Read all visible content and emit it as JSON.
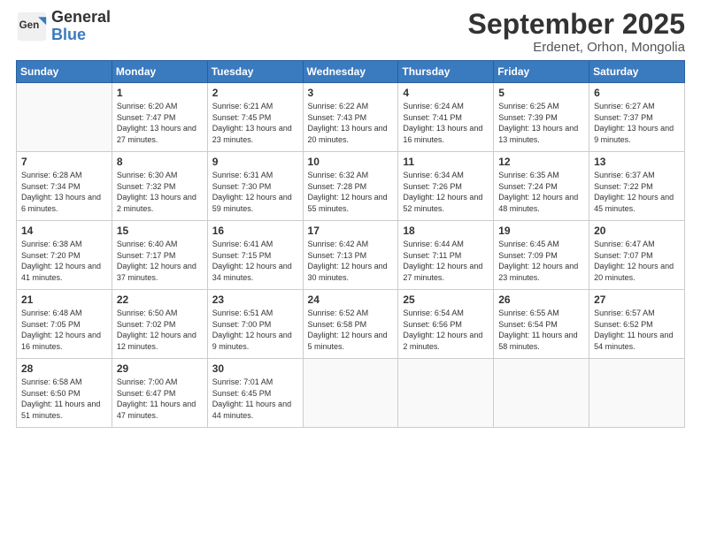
{
  "logo": {
    "general": "General",
    "blue": "Blue"
  },
  "title": {
    "month": "September 2025",
    "location": "Erdenet, Orhon, Mongolia"
  },
  "weekdays": [
    "Sunday",
    "Monday",
    "Tuesday",
    "Wednesday",
    "Thursday",
    "Friday",
    "Saturday"
  ],
  "weeks": [
    [
      {
        "day": "",
        "info": ""
      },
      {
        "day": "1",
        "info": "Sunrise: 6:20 AM\nSunset: 7:47 PM\nDaylight: 13 hours and 27 minutes."
      },
      {
        "day": "2",
        "info": "Sunrise: 6:21 AM\nSunset: 7:45 PM\nDaylight: 13 hours and 23 minutes."
      },
      {
        "day": "3",
        "info": "Sunrise: 6:22 AM\nSunset: 7:43 PM\nDaylight: 13 hours and 20 minutes."
      },
      {
        "day": "4",
        "info": "Sunrise: 6:24 AM\nSunset: 7:41 PM\nDaylight: 13 hours and 16 minutes."
      },
      {
        "day": "5",
        "info": "Sunrise: 6:25 AM\nSunset: 7:39 PM\nDaylight: 13 hours and 13 minutes."
      },
      {
        "day": "6",
        "info": "Sunrise: 6:27 AM\nSunset: 7:37 PM\nDaylight: 13 hours and 9 minutes."
      }
    ],
    [
      {
        "day": "7",
        "info": "Sunrise: 6:28 AM\nSunset: 7:34 PM\nDaylight: 13 hours and 6 minutes."
      },
      {
        "day": "8",
        "info": "Sunrise: 6:30 AM\nSunset: 7:32 PM\nDaylight: 13 hours and 2 minutes."
      },
      {
        "day": "9",
        "info": "Sunrise: 6:31 AM\nSunset: 7:30 PM\nDaylight: 12 hours and 59 minutes."
      },
      {
        "day": "10",
        "info": "Sunrise: 6:32 AM\nSunset: 7:28 PM\nDaylight: 12 hours and 55 minutes."
      },
      {
        "day": "11",
        "info": "Sunrise: 6:34 AM\nSunset: 7:26 PM\nDaylight: 12 hours and 52 minutes."
      },
      {
        "day": "12",
        "info": "Sunrise: 6:35 AM\nSunset: 7:24 PM\nDaylight: 12 hours and 48 minutes."
      },
      {
        "day": "13",
        "info": "Sunrise: 6:37 AM\nSunset: 7:22 PM\nDaylight: 12 hours and 45 minutes."
      }
    ],
    [
      {
        "day": "14",
        "info": "Sunrise: 6:38 AM\nSunset: 7:20 PM\nDaylight: 12 hours and 41 minutes."
      },
      {
        "day": "15",
        "info": "Sunrise: 6:40 AM\nSunset: 7:17 PM\nDaylight: 12 hours and 37 minutes."
      },
      {
        "day": "16",
        "info": "Sunrise: 6:41 AM\nSunset: 7:15 PM\nDaylight: 12 hours and 34 minutes."
      },
      {
        "day": "17",
        "info": "Sunrise: 6:42 AM\nSunset: 7:13 PM\nDaylight: 12 hours and 30 minutes."
      },
      {
        "day": "18",
        "info": "Sunrise: 6:44 AM\nSunset: 7:11 PM\nDaylight: 12 hours and 27 minutes."
      },
      {
        "day": "19",
        "info": "Sunrise: 6:45 AM\nSunset: 7:09 PM\nDaylight: 12 hours and 23 minutes."
      },
      {
        "day": "20",
        "info": "Sunrise: 6:47 AM\nSunset: 7:07 PM\nDaylight: 12 hours and 20 minutes."
      }
    ],
    [
      {
        "day": "21",
        "info": "Sunrise: 6:48 AM\nSunset: 7:05 PM\nDaylight: 12 hours and 16 minutes."
      },
      {
        "day": "22",
        "info": "Sunrise: 6:50 AM\nSunset: 7:02 PM\nDaylight: 12 hours and 12 minutes."
      },
      {
        "day": "23",
        "info": "Sunrise: 6:51 AM\nSunset: 7:00 PM\nDaylight: 12 hours and 9 minutes."
      },
      {
        "day": "24",
        "info": "Sunrise: 6:52 AM\nSunset: 6:58 PM\nDaylight: 12 hours and 5 minutes."
      },
      {
        "day": "25",
        "info": "Sunrise: 6:54 AM\nSunset: 6:56 PM\nDaylight: 12 hours and 2 minutes."
      },
      {
        "day": "26",
        "info": "Sunrise: 6:55 AM\nSunset: 6:54 PM\nDaylight: 11 hours and 58 minutes."
      },
      {
        "day": "27",
        "info": "Sunrise: 6:57 AM\nSunset: 6:52 PM\nDaylight: 11 hours and 54 minutes."
      }
    ],
    [
      {
        "day": "28",
        "info": "Sunrise: 6:58 AM\nSunset: 6:50 PM\nDaylight: 11 hours and 51 minutes."
      },
      {
        "day": "29",
        "info": "Sunrise: 7:00 AM\nSunset: 6:47 PM\nDaylight: 11 hours and 47 minutes."
      },
      {
        "day": "30",
        "info": "Sunrise: 7:01 AM\nSunset: 6:45 PM\nDaylight: 11 hours and 44 minutes."
      },
      {
        "day": "",
        "info": ""
      },
      {
        "day": "",
        "info": ""
      },
      {
        "day": "",
        "info": ""
      },
      {
        "day": "",
        "info": ""
      }
    ]
  ]
}
